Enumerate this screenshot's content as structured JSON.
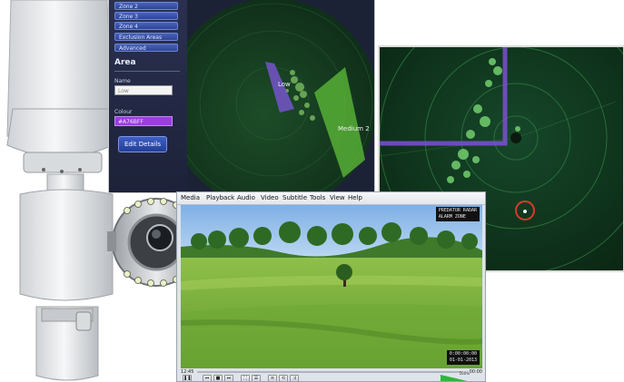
{
  "zone_editor": {
    "zones": [
      "Zone 2",
      "Zone 3",
      "Zone 4"
    ],
    "exclusion_label": "Exclusion Areas",
    "advanced_label": "Advanced",
    "section_heading": "Area",
    "name_label": "Name",
    "name_value": "Low",
    "colour_label": "Colour",
    "colour_value": "#A76BFF",
    "edit_button": "Edit Details",
    "zone_label_low": "Low",
    "zone_label_medium": "Medium 2",
    "colors": {
      "zone_purple": "#7a55d6",
      "zone_green": "#5fbf3a",
      "radar_bg": "#123a1f"
    }
  },
  "player": {
    "menu": [
      "Media",
      "Playback",
      "Audio",
      "Video",
      "Subtitle",
      "Tools",
      "View",
      "Help"
    ],
    "overlay_top_line1": "PREDATOR RADAR",
    "overlay_top_line2": "ALARM ZONE",
    "overlay_bottom_line1": "0:00:00:00",
    "overlay_bottom_line2": "01-01-2013",
    "time_elapsed": "12:45",
    "time_total": "00:00",
    "volume_pct": "100%",
    "control_icons": [
      "pause-icon",
      "prev-icon",
      "stop-icon",
      "next-icon",
      "fullscreen-icon",
      "playlist-icon",
      "ext-settings-icon",
      "loop-icon",
      "shuffle-icon"
    ],
    "control_glyphs": [
      "❚❚",
      "⏮",
      "■",
      "⏭",
      "⛶",
      "☰",
      "≡",
      "⟲",
      "⤨"
    ]
  }
}
